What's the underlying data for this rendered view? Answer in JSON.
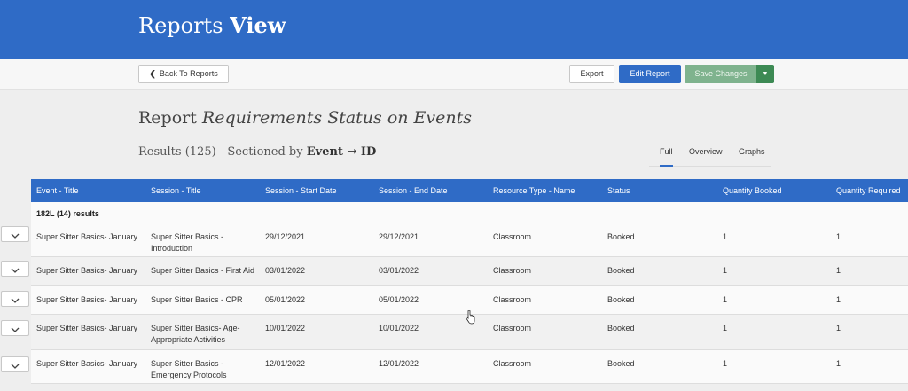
{
  "header": {
    "title_main": "Reports",
    "title_bold": "View",
    "color": "#2f6bc6"
  },
  "toolbar": {
    "back_label": "Back To Reports",
    "export_label": "Export",
    "edit_label": "Edit Report",
    "save_label": "Save Changes"
  },
  "report": {
    "prefix": "Report",
    "name": "Requirements Status on Events",
    "results_prefix": "Results (125) - Sectioned by",
    "section_field": "Event → ID"
  },
  "tabs": [
    {
      "label": "Full",
      "active": true
    },
    {
      "label": "Overview",
      "active": false
    },
    {
      "label": "Graphs",
      "active": false
    }
  ],
  "table": {
    "columns": [
      "Event - Title",
      "Session - Title",
      "Session - Start Date",
      "Session - End Date",
      "Resource Type - Name",
      "Status",
      "Quantity Booked",
      "Quantity Required"
    ],
    "section_label": "182L (14) results",
    "rows": [
      [
        "Super Sitter Basics- January",
        "Super Sitter Basics -",
        "Introduction",
        "29/12/2021",
        "29/12/2021",
        "Classroom",
        "Booked",
        "1",
        "1"
      ],
      [
        "Super Sitter Basics- January",
        "Super Sitter Basics - First Aid",
        "",
        "03/01/2022",
        "03/01/2022",
        "Classroom",
        "Booked",
        "1",
        "1"
      ],
      [
        "Super Sitter Basics- January",
        "Super Sitter Basics - CPR",
        "",
        "05/01/2022",
        "05/01/2022",
        "Classroom",
        "Booked",
        "1",
        "1"
      ],
      [
        "Super Sitter Basics- January",
        "Super Sitter Basics- Age-",
        "Appropriate Activities",
        "10/01/2022",
        "10/01/2022",
        "Classroom",
        "Booked",
        "1",
        "1"
      ],
      [
        "Super Sitter Basics- January",
        "Super Sitter Basics -",
        "Emergency Protocols",
        "12/01/2022",
        "12/01/2022",
        "Classroom",
        "Booked",
        "1",
        "1"
      ]
    ]
  }
}
